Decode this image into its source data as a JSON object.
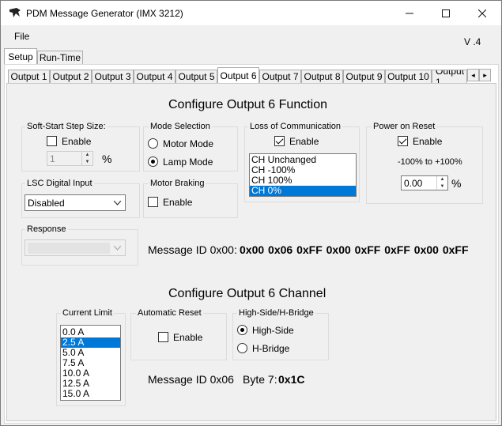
{
  "window": {
    "title": "PDM Message Generator (IMX 3212)",
    "controls": {
      "minimize": "–",
      "maximize": "☐",
      "close": "✕"
    }
  },
  "menu": {
    "file": "File"
  },
  "version": "V .4",
  "top_tabs": [
    {
      "label": "Setup",
      "active": true
    },
    {
      "label": "Run-Time",
      "active": false
    }
  ],
  "output_tabs": [
    {
      "label": "Output 1"
    },
    {
      "label": "Output 2"
    },
    {
      "label": "Output 3"
    },
    {
      "label": "Output 4"
    },
    {
      "label": "Output 5"
    },
    {
      "label": "Output 6",
      "active": true
    },
    {
      "label": "Output 7"
    },
    {
      "label": "Output 8"
    },
    {
      "label": "Output 9"
    },
    {
      "label": "Output 10"
    },
    {
      "label": "Output 1"
    }
  ],
  "tab_scroll": {
    "left": "◂",
    "right": "▸"
  },
  "function": {
    "heading": "Configure Output 6 Function",
    "soft_start": {
      "label": "Soft-Start Step Size:",
      "enable_label": "Enable",
      "enabled": false,
      "value": "1",
      "unit": "%"
    },
    "mode_selection": {
      "label": "Mode Selection",
      "options": [
        "Motor Mode",
        "Lamp Mode"
      ],
      "selected": "Lamp Mode"
    },
    "loss_comm": {
      "label": "Loss of Communication",
      "enable_label": "Enable",
      "enabled": true,
      "items": [
        "CH Unchanged",
        "CH -100%",
        "CH 100%",
        "CH 0%"
      ],
      "selected_index": 3
    },
    "power_reset": {
      "label": "Power on Reset",
      "enable_label": "Enable",
      "enabled": true,
      "range_text": "-100% to +100%",
      "value": "0.00",
      "unit": "%"
    },
    "lsc_input": {
      "label": "LSC Digital Input",
      "value": "Disabled"
    },
    "motor_braking": {
      "label": "Motor Braking",
      "enable_label": "Enable",
      "enabled": false
    },
    "response": {
      "label": "Response",
      "value": ""
    },
    "message": {
      "prefix": "Message ID 0x00:",
      "bytes": "0x00 0x06 0xFF 0x00 0xFF 0xFF 0x00 0xFF"
    }
  },
  "channel": {
    "heading": "Configure Output 6 Channel",
    "current_limit": {
      "label": "Current Limit",
      "items": [
        "0.0 A",
        "2.5 A",
        "5.0 A",
        "7.5 A",
        "10.0 A",
        "12.5 A",
        "15.0 A"
      ],
      "selected_index": 1
    },
    "auto_reset": {
      "label": "Automatic Reset",
      "enable_label": "Enable",
      "enabled": false
    },
    "high_side": {
      "label": "High-Side/H-Bridge",
      "options": [
        "High-Side",
        "H-Bridge"
      ],
      "selected": "High-Side"
    },
    "message": {
      "prefix": "Message ID 0x06",
      "byte_label": "Byte 7:",
      "value": "0x1C"
    }
  }
}
